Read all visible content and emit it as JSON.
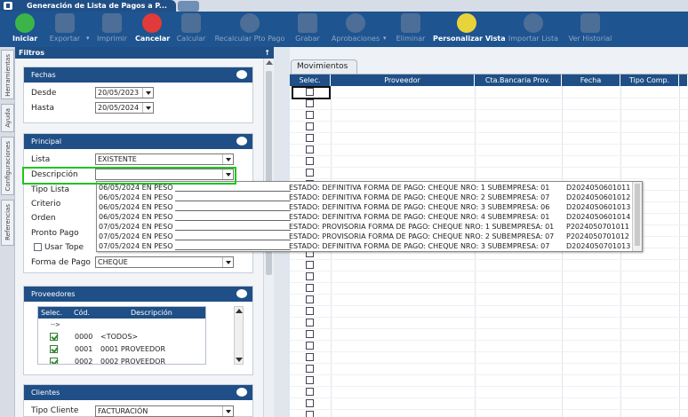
{
  "window": {
    "title": "Generación de Lista de Pagos a P..."
  },
  "toolbar": {
    "iniciar": "Iniciar",
    "exportar": "Exportar",
    "imprimir": "Imprimir",
    "cancelar": "Cancelar",
    "calcular": "Calcular",
    "recalcular": "Recalcular Pto Pago",
    "grabar": "Grabar",
    "aprobaciones": "Aprobaciones",
    "eliminar": "Eliminar",
    "personalizar": "Personalizar Vista",
    "importar": "Importar Lista",
    "ver_historial": "Ver Historial"
  },
  "side_tabs": {
    "herramientas": "Herramientas",
    "ayuda": "Ayuda",
    "configuraciones": "Configuraciones",
    "referencias": "Referencias"
  },
  "filtros": {
    "title": "Filtros",
    "pin": "↑",
    "fechas": {
      "title": "Fechas",
      "desde_label": "Desde",
      "desde_value": "20/05/2023",
      "hasta_label": "Hasta",
      "hasta_value": "20/05/2024"
    },
    "principal": {
      "title": "Principal",
      "lista_label": "Lista",
      "lista_value": "EXISTENTE",
      "descripcion_label": "Descripción",
      "descripcion_value": "",
      "tipo_lista_label": "Tipo Lista",
      "criterio_label": "Criterio",
      "orden_label": "Orden",
      "pronto_pago_label": "Pronto Pago",
      "usar_tope_label": "Usar Tope",
      "forma_pago_label": "Forma de Pago",
      "forma_pago_value": "CHEQUE"
    },
    "proveedores": {
      "title": "Proveedores",
      "columns": [
        "Selec.",
        "Cód.",
        "Descripción"
      ],
      "arrow_row": "-->",
      "rows": [
        {
          "code": "0000",
          "desc": "<TODOS>",
          "checked": true
        },
        {
          "code": "0001",
          "desc": "0001 PROVEEDOR",
          "checked": true
        },
        {
          "code": "0002",
          "desc": "0002 PROVEEDOR",
          "checked": true
        }
      ]
    },
    "clientes": {
      "title": "Clientes",
      "tipo_cliente_label": "Tipo Cliente",
      "tipo_cliente_value": "FACTURACIÓN"
    }
  },
  "movimientos": {
    "tab": "Movimientos",
    "columns": [
      "Selec.",
      "Proveedor",
      "Cta.Bancaria Prov.",
      "Fecha",
      "Tipo Comp."
    ]
  },
  "descripcion_dropdown": [
    {
      "left": "06/05/2024 EN PESO",
      "mid": "ESTADO: DEFINITIVA FORMA DE PAGO: CHEQUE NRO: 1 SUBEMPRESA: 01",
      "code": "D2024050601011"
    },
    {
      "left": "06/05/2024 EN PESO",
      "mid": "ESTADO: DEFINITIVA FORMA DE PAGO: CHEQUE NRO: 2 SUBEMPRESA: 07",
      "code": "D2024050601012"
    },
    {
      "left": "06/05/2024 EN PESO",
      "mid": "ESTADO: DEFINITIVA FORMA DE PAGO: CHEQUE NRO: 3 SUBEMPRESA: 06",
      "code": "D2024050601013"
    },
    {
      "left": "06/05/2024 EN PESO",
      "mid": "ESTADO: DEFINITIVA FORMA DE PAGO: CHEQUE NRO: 4 SUBEMPRESA: 01",
      "code": "D2024050601014"
    },
    {
      "left": "07/05/2024 EN PESO",
      "mid": "ESTADO: PROVISORIA FORMA DE PAGO: CHEQUE NRO: 1 SUBEMPRESA: 01",
      "code": "P2024050701011"
    },
    {
      "left": "07/05/2024 EN PESO",
      "mid": "ESTADO: PROVISORIA FORMA DE PAGO: CHEQUE NRO: 2 SUBEMPRESA: 07",
      "code": "P2024050701012"
    },
    {
      "left": "07/05/2024 EN PESO",
      "mid": "ESTADO: DEFINITIVA FORMA DE PAGO: CHEQUE NRO: 3 SUBEMPRESA: 07",
      "code": "D2024050701013"
    }
  ],
  "colors": {
    "brand": "#1f4f86",
    "highlight": "#22c322"
  }
}
